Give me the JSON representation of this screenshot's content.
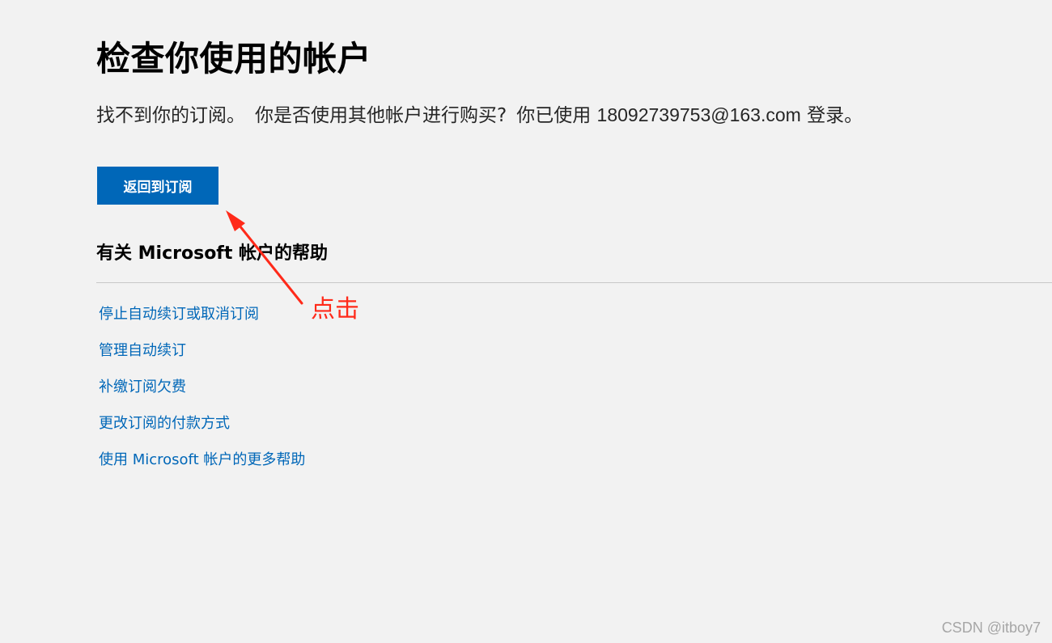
{
  "page": {
    "title": "检查你使用的帐户",
    "message": {
      "part1": "找不到你的订阅。",
      "part2": "你是否使用其他帐户进行购买?",
      "part3_prefix": "你已使用",
      "email": "18092739753@163.com",
      "part3_suffix": "登录。"
    },
    "primary_button_label": "返回到订阅"
  },
  "help": {
    "heading": "有关 Microsoft 帐户的帮助",
    "links": [
      "停止自动续订或取消订阅",
      "管理自动续订",
      "补缴订阅欠费",
      "更改订阅的付款方式",
      "使用 Microsoft 帐户的更多帮助"
    ]
  },
  "annotation": {
    "label": "点击",
    "color": "#ff2a1a"
  },
  "watermark": "CSDN @itboy7",
  "colors": {
    "background": "#f2f2f2",
    "accent": "#0067b8",
    "link": "#0067b8"
  }
}
